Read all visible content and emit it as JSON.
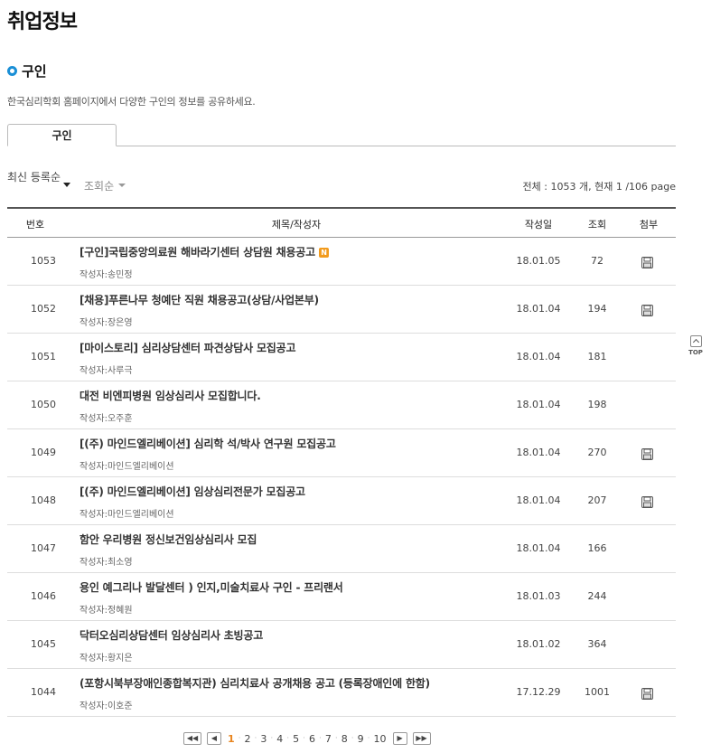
{
  "page": {
    "title": "취업정보"
  },
  "section": {
    "title": "구인",
    "description": "한국심리학회 홈페이지에서 다양한 구인의 정보를 공유하세요."
  },
  "tabs": [
    {
      "label": "구인",
      "active": true
    }
  ],
  "sort": {
    "latest_label": "최신 등록순",
    "views_label": "조회순",
    "total_info": "전체 : 1053 개, 현재 1 /106 page"
  },
  "table": {
    "headers": {
      "no": "번호",
      "title": "제목/작성자",
      "date": "작성일",
      "views": "조회",
      "attach": "첨부"
    },
    "rows": [
      {
        "no": "1053",
        "title": "[구인]국립중앙의료원 해바라기센터 상담원 채용공고",
        "author": "작성자:송민정",
        "date": "18.01.05",
        "views": "72",
        "attach": true,
        "new": true
      },
      {
        "no": "1052",
        "title": "[채용]푸른나무 청예단 직원 채용공고(상담/사업본부)",
        "author": "작성자:장은영",
        "date": "18.01.04",
        "views": "194",
        "attach": true,
        "new": false
      },
      {
        "no": "1051",
        "title": "[마이스토리] 심리상담센터 파견상담사 모집공고",
        "author": "작성자:사루극",
        "date": "18.01.04",
        "views": "181",
        "attach": false,
        "new": false
      },
      {
        "no": "1050",
        "title": "대전 비엔피병원 임상심리사 모집합니다.",
        "author": "작성자:오주훈",
        "date": "18.01.04",
        "views": "198",
        "attach": false,
        "new": false
      },
      {
        "no": "1049",
        "title": "[(주) 마인드엘리베이션] 심리학 석/박사 연구원 모집공고",
        "author": "작성자:마인드엘리베이션",
        "date": "18.01.04",
        "views": "270",
        "attach": true,
        "new": false
      },
      {
        "no": "1048",
        "title": "[(주) 마인드엘리베이션] 임상심리전문가 모집공고",
        "author": "작성자:마인드엘리베이션",
        "date": "18.01.04",
        "views": "207",
        "attach": true,
        "new": false
      },
      {
        "no": "1047",
        "title": "함안 우리병원 정신보건임상심리사 모집",
        "author": "작성자:최소영",
        "date": "18.01.04",
        "views": "166",
        "attach": false,
        "new": false
      },
      {
        "no": "1046",
        "title": "용인 예그리나 발달센터 ) 인지,미술치료사 구인 - 프리랜서",
        "author": "작성자:정혜원",
        "date": "18.01.03",
        "views": "244",
        "attach": false,
        "new": false
      },
      {
        "no": "1045",
        "title": "닥터오심리상담센터 임상심리사 초빙공고",
        "author": "작성자:황지은",
        "date": "18.01.02",
        "views": "364",
        "attach": false,
        "new": false
      },
      {
        "no": "1044",
        "title": "(포항시북부장애인종합복지관) 심리치료사 공개채용 공고 (등록장애인에 한함)",
        "author": "작성자:이호준",
        "date": "17.12.29",
        "views": "1001",
        "attach": true,
        "new": false
      }
    ]
  },
  "new_badge": "N",
  "top_button": {
    "label": "TOP"
  },
  "pagination": {
    "pages": [
      "1",
      "2",
      "3",
      "4",
      "5",
      "6",
      "7",
      "8",
      "9",
      "10"
    ],
    "current": "1"
  },
  "colors": {
    "accent": "#1a8fd6",
    "current_page": "#e8851f",
    "new_badge": "#f29b1d"
  }
}
